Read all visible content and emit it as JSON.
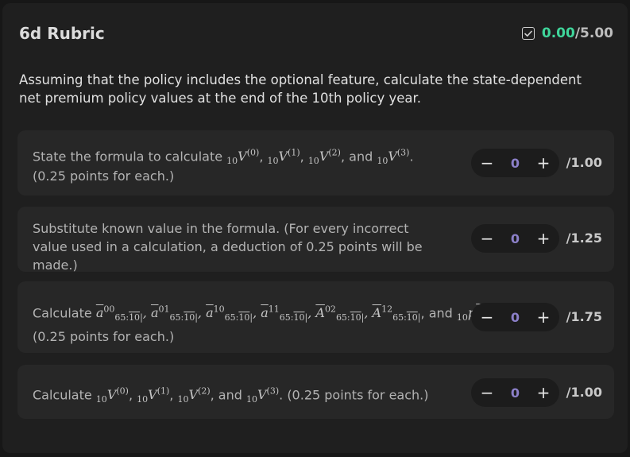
{
  "title": "6d Rubric",
  "score": {
    "earned": "0.00",
    "separator": "/",
    "total": "5.00",
    "icon": "checkbox-icon"
  },
  "question": "Assuming that the policy includes the optional feature, calculate the state-dependent net premium policy values at the end of the 10th policy year.",
  "criteria": [
    {
      "text_a": "State the formula to calculate ",
      "text_b": ", ",
      "text_c": ", ",
      "text_d": ", and ",
      "text_e": ".",
      "line2": "(0.25 points for each.)",
      "value": "0",
      "max": "/1.00"
    },
    {
      "text": "Substitute known value in the formula. (For every incorrect value used in a calculation, a deduction of 0.25 points will be made.)",
      "value": "0",
      "max": "/1.25"
    },
    {
      "text_a": "Calculate ",
      "text_and": ", and ",
      "text_end": ".",
      "line2": "(0.25 points for each.)",
      "value": "0",
      "max": "/1.75"
    },
    {
      "text_a": "Calculate ",
      "text_b": ", ",
      "text_c": ", ",
      "text_d": ", and ",
      "text_e": ". (0.25 points for each.)",
      "value": "0",
      "max": "/1.00"
    }
  ],
  "stepper": {
    "minus": "−",
    "plus": "+"
  },
  "colors": {
    "earned": "#3fd69b",
    "value": "#8c80c9",
    "background": "#1f1f1f"
  }
}
